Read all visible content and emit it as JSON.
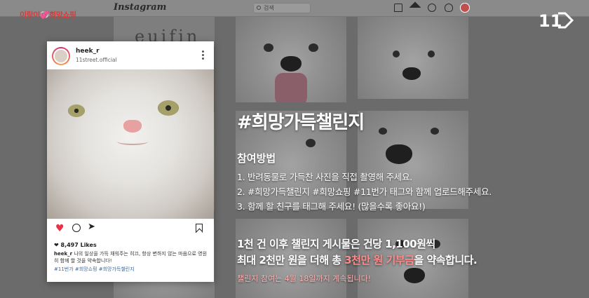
{
  "top_tag": {
    "left": "이랑이",
    "hearts": "💞",
    "right": "희망쇼핑"
  },
  "brand_logo": {
    "text": "11",
    "color": "#ffffff"
  },
  "instagram_bar": {
    "logo": "Instagram",
    "search_placeholder": "검색",
    "icons": [
      "home-icon",
      "send-icon",
      "compass-icon",
      "heart-icon",
      "profile-avatar"
    ]
  },
  "background_tile_text": "euifin",
  "post": {
    "username": "heek_r",
    "subtitle": "11street.official",
    "likes": "8,497 Likes",
    "caption_user": "heek_r",
    "caption_text": "나의 일상을 가득 채워주는 히끄, 항상 변하지 않는 마음으로 영원히 함께 할 것을 약속합니다!",
    "hashtags": "#11번가 #희망쇼핑 #희망가득챌린지",
    "heart_color": "#e8334a"
  },
  "challenge": {
    "title": "#희망가득챌린지",
    "how_heading": "참여방법",
    "steps": [
      "1. 반려동물로 가득찬 사진을 직접 촬영해 주세요.",
      "2. #희망가득챌린지 #희망쇼핑 #11번가 태그와 함께 업로드해주세요.",
      "3. 함께 할 친구를 태그해 주세요! (많을수록 좋아요!)"
    ],
    "donation_line1": "1천 건 이후 챌린지 게시물은 건당 1,100원씩",
    "donation_line2_pre": "최대 2천만 원을 더해 총 ",
    "donation_line2_highlight": "3천만 원 기부금",
    "donation_line2_post": "을 약속합니다.",
    "period": "챌린지 참여는 4월 18일까지 계속됩니다!",
    "highlight_color": "#ff8a8a"
  }
}
